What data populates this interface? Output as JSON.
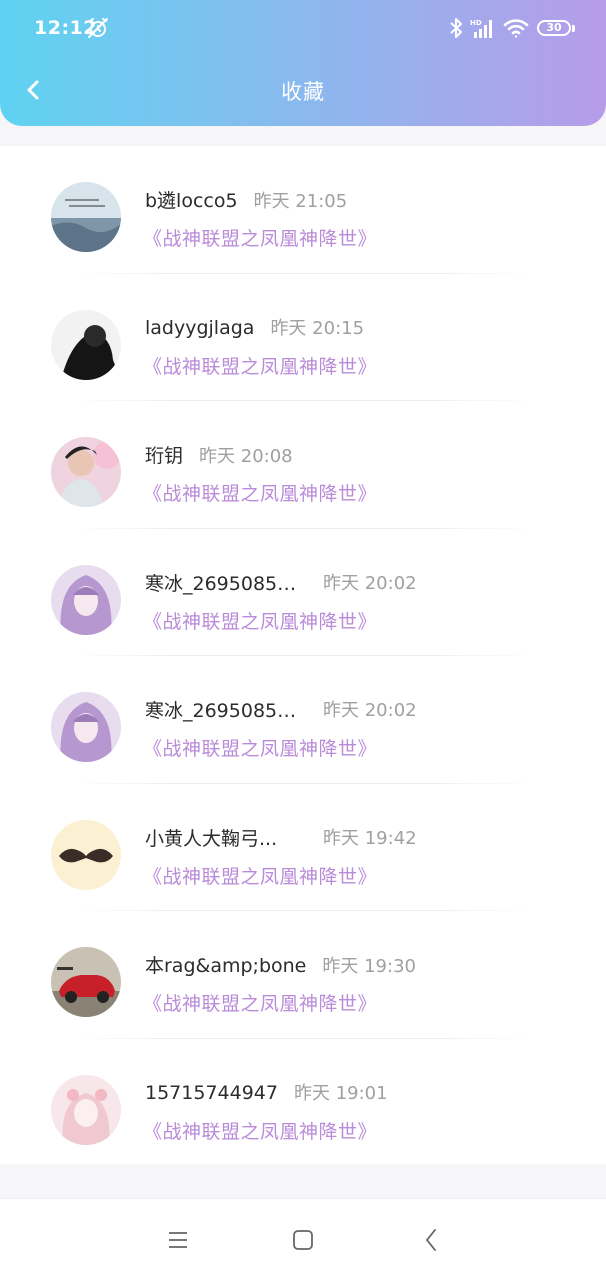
{
  "status_bar": {
    "time": "12:12",
    "battery": "30"
  },
  "header": {
    "title": "收藏"
  },
  "items": [
    {
      "name": "b遴locco5",
      "time": "昨天 21:05",
      "book": "《战神联盟之凤凰神降世》"
    },
    {
      "name": "ladyygjlaga",
      "time": "昨天 20:15",
      "book": "《战神联盟之凤凰神降世》"
    },
    {
      "name": "珩钥",
      "time": "昨天 20:08",
      "book": "《战神联盟之凤凰神降世》"
    },
    {
      "name": "寒冰_26950853...",
      "time": "昨天 20:02",
      "book": "《战神联盟之凤凰神降世》"
    },
    {
      "name": "寒冰_26950853...",
      "time": "昨天 20:02",
      "book": "《战神联盟之凤凰神降世》"
    },
    {
      "name": "小黄人大鞠弓...",
      "time": "昨天 19:42",
      "book": "《战神联盟之凤凰神降世》"
    },
    {
      "name": "本rag&amp;bone",
      "time": "昨天 19:30",
      "book": "《战神联盟之凤凰神降世》"
    },
    {
      "name": "15715744947",
      "time": "昨天 19:01",
      "book": "《战神联盟之凤凰神降世》"
    }
  ],
  "colors": {
    "accent": "#b98bd8",
    "header_start": "#5fd3f1",
    "header_end": "#b79ce9"
  }
}
